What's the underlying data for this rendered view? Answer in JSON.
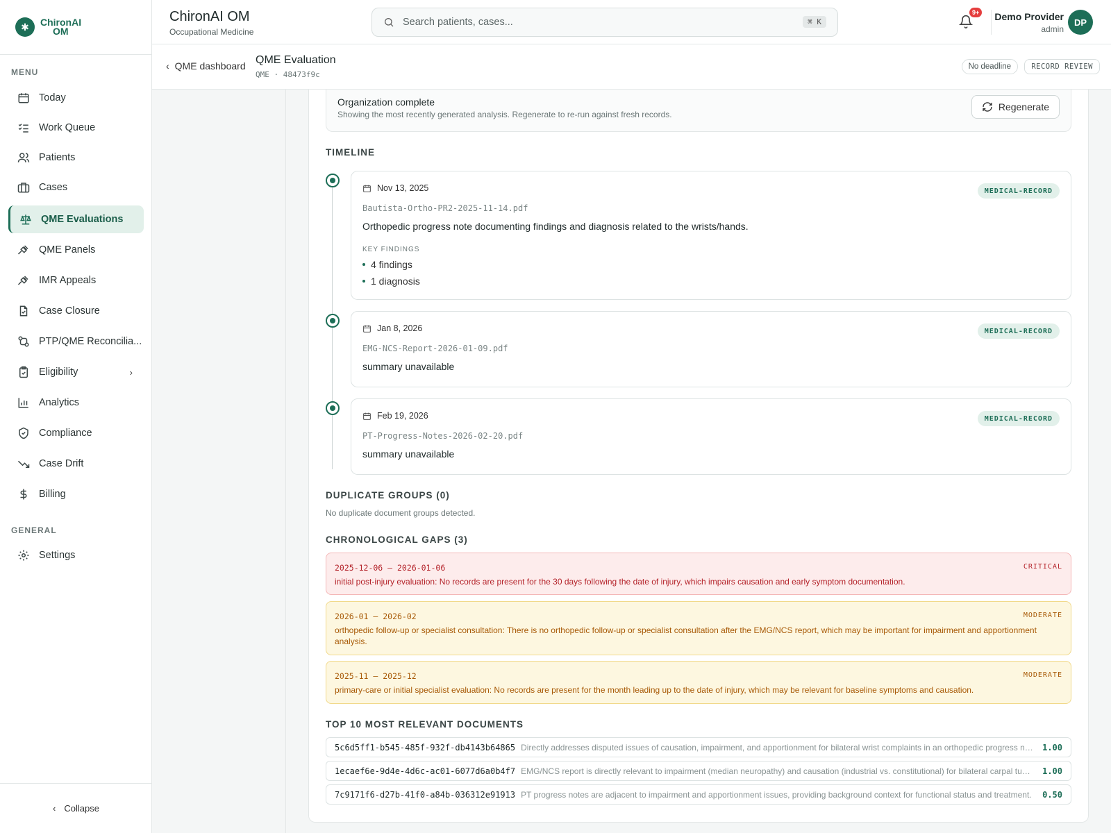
{
  "sidebar": {
    "logo_line1": "ChironAI",
    "logo_line2": "OM",
    "menu_label": "MENU",
    "general_label": "GENERAL",
    "items": [
      {
        "label": "Today",
        "icon": "calendar-icon"
      },
      {
        "label": "Work Queue",
        "icon": "list-check-icon"
      },
      {
        "label": "Patients",
        "icon": "users-icon"
      },
      {
        "label": "Cases",
        "icon": "briefcase-icon"
      },
      {
        "label": "QME Evaluations",
        "icon": "scale-icon",
        "active": true
      },
      {
        "label": "QME Panels",
        "icon": "gavel-icon"
      },
      {
        "label": "IMR Appeals",
        "icon": "gavel-icon"
      },
      {
        "label": "Case Closure",
        "icon": "file-check-icon"
      },
      {
        "label": "PTP/QME Reconcilia...",
        "icon": "git-compare-icon"
      },
      {
        "label": "Eligibility",
        "icon": "clipboard-check-icon",
        "has_chevron": true
      },
      {
        "label": "Analytics",
        "icon": "bar-chart-icon"
      },
      {
        "label": "Compliance",
        "icon": "shield-check-icon"
      },
      {
        "label": "Case Drift",
        "icon": "trending-down-icon"
      },
      {
        "label": "Billing",
        "icon": "dollar-icon"
      }
    ],
    "settings_label": "Settings",
    "collapse_label": "Collapse"
  },
  "topbar": {
    "app_title": "ChironAI OM",
    "app_subtitle": "Occupational Medicine",
    "search_placeholder": "Search patients, cases...",
    "search_shortcut": "⌘ K",
    "notification_count": "9+",
    "user_name": "Demo Provider",
    "user_role": "admin",
    "user_initials": "DP"
  },
  "subheader": {
    "back_label": "QME dashboard",
    "title": "QME Evaluation",
    "id_line": "QME · 48473f9c",
    "deadline_pill": "No deadline",
    "stage_pill": "RECORD REVIEW"
  },
  "organization": {
    "title": "Organization complete",
    "subtitle": "Showing the most recently generated analysis. Regenerate to re-run against fresh records.",
    "regenerate_label": "Regenerate"
  },
  "timeline": {
    "heading": "TIMELINE",
    "key_findings_label": "KEY FINDINGS",
    "entries": [
      {
        "date": "Nov 13, 2025",
        "file": "Bautista-Ortho-PR2-2025-11-14.pdf",
        "summary": "Orthopedic progress note documenting findings and diagnosis related to the wrists/hands.",
        "tag": "MEDICAL-RECORD",
        "findings": [
          "4 findings",
          "1 diagnosis"
        ]
      },
      {
        "date": "Jan 8, 2026",
        "file": "EMG-NCS-Report-2026-01-09.pdf",
        "summary": "summary unavailable",
        "tag": "MEDICAL-RECORD"
      },
      {
        "date": "Feb 19, 2026",
        "file": "PT-Progress-Notes-2026-02-20.pdf",
        "summary": "summary unavailable",
        "tag": "MEDICAL-RECORD"
      }
    ]
  },
  "duplicates": {
    "heading": "DUPLICATE GROUPS (0)",
    "note": "No duplicate document groups detected."
  },
  "gaps": {
    "heading": "CHRONOLOGICAL GAPS (3)",
    "items": [
      {
        "range": "2025-12-06 – 2026-01-06",
        "severity": "CRITICAL",
        "text": "initial post-injury evaluation: No records are present for the 30 days following the date of injury, which impairs causation and early symptom documentation."
      },
      {
        "range": "2026-01 – 2026-02",
        "severity": "MODERATE",
        "text": "orthopedic follow-up or specialist consultation: There is no orthopedic follow-up or specialist consultation after the EMG/NCS report, which may be important for impairment and apportionment analysis."
      },
      {
        "range": "2025-11 – 2025-12",
        "severity": "MODERATE",
        "text": "primary-care or initial specialist evaluation: No records are present for the month leading up to the date of injury, which may be relevant for baseline symptoms and causation."
      }
    ]
  },
  "top_docs": {
    "heading": "TOP 10 MOST RELEVANT DOCUMENTS",
    "items": [
      {
        "id": "5c6d5ff1-b545-485f-932f-db4143b64865",
        "desc": "Directly addresses disputed issues of causation, impairment, and apportionment for bilateral wrist complaints in an orthopedic progress note.",
        "score": "1.00"
      },
      {
        "id": "1ecaef6e-9d4e-4d6c-ac01-6077d6a0b4f7",
        "desc": "EMG/NCS report is directly relevant to impairment (median neuropathy) and causation (industrial vs. constitutional) for bilateral carpal tunnel.",
        "score": "1.00"
      },
      {
        "id": "7c9171f6-d27b-41f0-a84b-036312e91913",
        "desc": "PT progress notes are adjacent to impairment and apportionment issues, providing background context for functional status and treatment.",
        "score": "0.50"
      }
    ]
  },
  "colors": {
    "accent": "#1d6e57",
    "critical": "#b4232a",
    "moderate": "#a85a07"
  }
}
